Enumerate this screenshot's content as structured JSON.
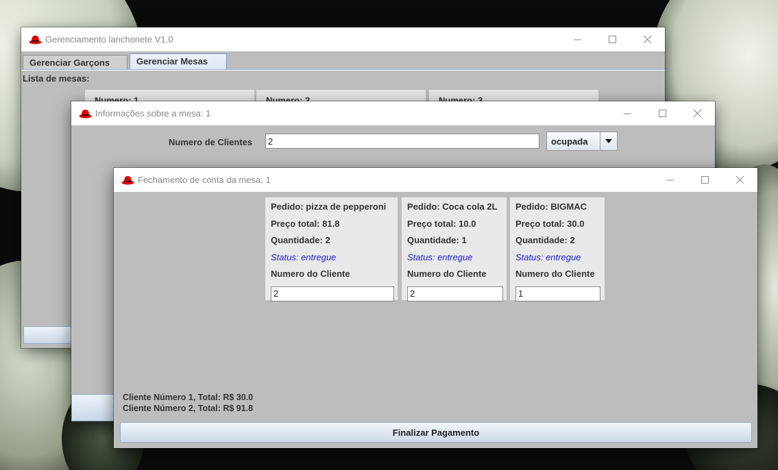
{
  "windows": {
    "main": {
      "title": "Gerenciamento lanchonete V1.0",
      "tabs": [
        "Gerenciar Garçons",
        "Gerenciar Mesas"
      ],
      "active_tab": "Gerenciar Mesas",
      "list_label": "Lista de mesas:",
      "mesas": [
        "Numero: 1",
        "Numero: 2",
        "Numero: 3"
      ]
    },
    "info": {
      "title": "Informações sobre a mesa: 1",
      "clients_label": "Numero de Clientes",
      "clients_value": "2",
      "status_value": "ocupada"
    },
    "closing": {
      "title": "Fechamento de conta da mesa: 1",
      "orders": [
        {
          "pedido": "Pedido: pizza de pepperoni",
          "preco": "Preço total: 81.8",
          "quantidade": "Quantidade: 2",
          "status": "Status: entregue",
          "cliente_label": "Numero do Cliente",
          "cliente": "2"
        },
        {
          "pedido": "Pedido: Coca cola 2L",
          "preco": "Preço total: 10.0",
          "quantidade": "Quantidade: 1",
          "status": "Status: entregue",
          "cliente_label": "Numero do Cliente",
          "cliente": "2"
        },
        {
          "pedido": "Pedido: BIGMAC",
          "preco": "Preço total: 30.0",
          "quantidade": "Quantidade: 2",
          "status": "Status: entregue",
          "cliente_label": "Numero do Cliente",
          "cliente": "1"
        }
      ],
      "totals": [
        {
          "prefix": "Cliente Número ",
          "num": "1",
          "suffix": ", Total: R$ 30.0"
        },
        {
          "prefix": "Cliente Número ",
          "num": "2",
          "suffix": ", Total: R$ 91.8"
        }
      ],
      "finalize_label": "Finalizar Pagamento"
    }
  },
  "icons": {
    "app_icon": "red-hat-icon",
    "minimize": "minimize-icon",
    "maximize": "maximize-icon",
    "close": "close-icon",
    "dropdown": "triangle-down-icon"
  },
  "colors": {
    "panel_bg": "#bdbdbd",
    "card_bg": "#e9e9e9",
    "status_text": "#2020c8",
    "hat_red": "#e00000"
  }
}
